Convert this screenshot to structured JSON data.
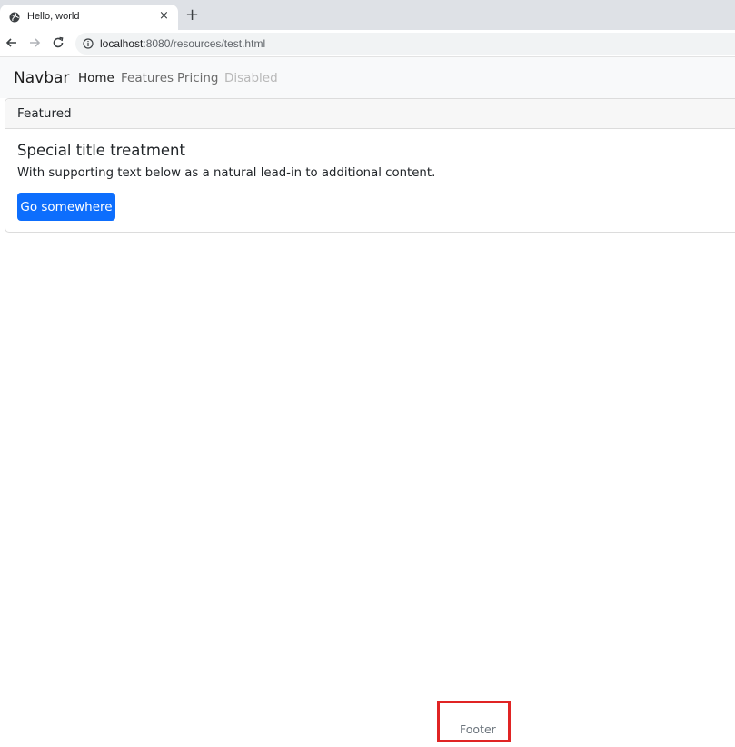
{
  "browser": {
    "tab_title": "Hello, world",
    "tab_close": "×",
    "new_tab": "+",
    "url_host": "localhost",
    "url_rest": ":8080/resources/test.html"
  },
  "navbar": {
    "brand": "Navbar",
    "links": [
      {
        "label": "Home",
        "color": "#1e1e1e"
      },
      {
        "label": "Features",
        "color": "#6c6c6c"
      },
      {
        "label": "Pricing",
        "color": "#6c6c6c"
      },
      {
        "label": "Disabled",
        "color": "#b8b8b8"
      }
    ]
  },
  "card": {
    "header": "Featured",
    "title": "Special title treatment",
    "text": "With supporting text below as a natural lead-in to additional content.",
    "button": "Go somewhere",
    "button_color": "#0d6efd"
  },
  "footer": {
    "text": "Footer",
    "highlight_color": "#e02424"
  }
}
